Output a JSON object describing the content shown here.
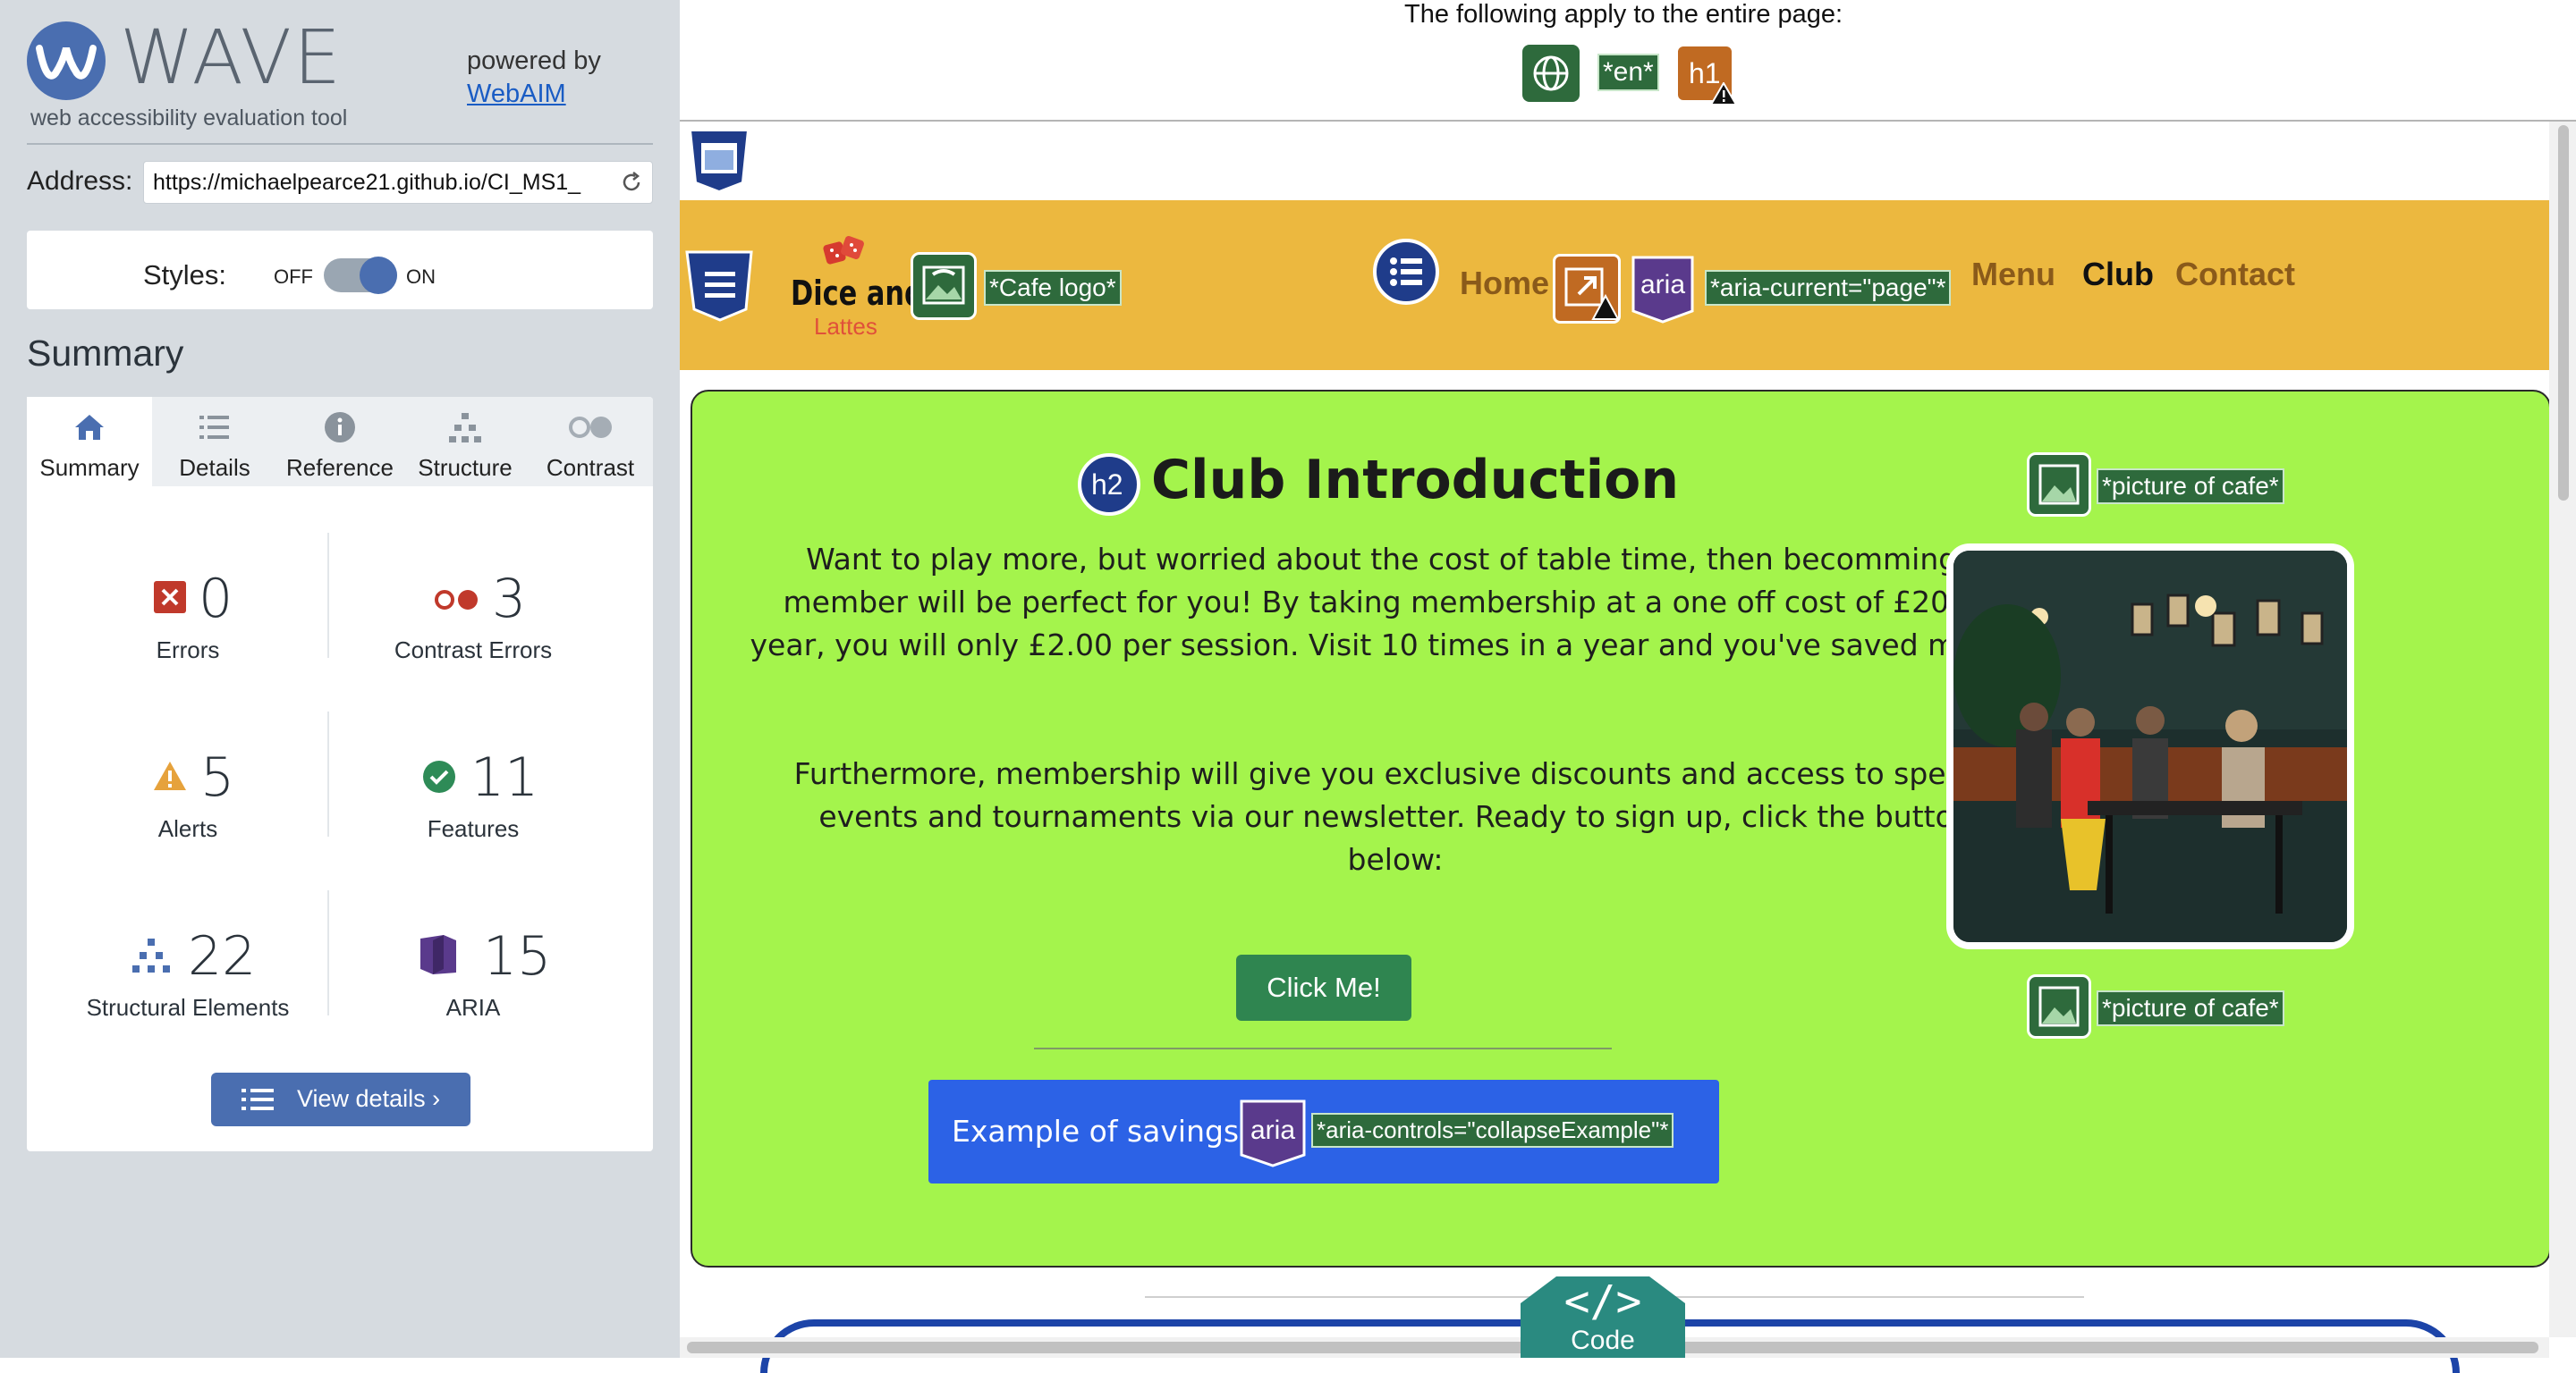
{
  "wave": {
    "title": "WAVE",
    "tagline": "web accessibility evaluation tool",
    "powered_by": "powered by",
    "webaim_link": "WebAIM",
    "address_label": "Address:",
    "address_value": "https://michaelpearce21.github.io/CI_MS1_",
    "styles_label": "Styles:",
    "styles_off": "OFF",
    "styles_on": "ON",
    "summary_heading": "Summary",
    "tabs": [
      {
        "label": "Summary",
        "icon": "home-icon"
      },
      {
        "label": "Details",
        "icon": "list-icon"
      },
      {
        "label": "Reference",
        "icon": "info-icon"
      },
      {
        "label": "Structure",
        "icon": "hierarchy-icon"
      },
      {
        "label": "Contrast",
        "icon": "contrast-icon"
      }
    ],
    "stats": {
      "errors": {
        "count": "0",
        "label": "Errors"
      },
      "contrast_errors": {
        "count": "3",
        "label": "Contrast Errors"
      },
      "alerts": {
        "count": "5",
        "label": "Alerts"
      },
      "features": {
        "count": "11",
        "label": "Features"
      },
      "structural": {
        "count": "22",
        "label": "Structural Elements"
      },
      "aria": {
        "count": "15",
        "label": "ARIA"
      }
    },
    "view_details": "View details ›",
    "accent": "#4a6eb0"
  },
  "page_level": {
    "text": "The following apply to the entire page:",
    "lang_tag": "*en*",
    "h1_tag": "h1"
  },
  "site": {
    "logo_line1": "Dice and",
    "logo_line2": "Lattes",
    "cafe_logo_alt": "*Cafe logo*",
    "nav": {
      "home": "Home",
      "aria_tag": "aria",
      "aria_current": "*aria-current=\"page\"*",
      "menu": "Menu",
      "club": "Club",
      "contact": "Contact"
    },
    "h2_tag": "h2",
    "heading": "Club Introduction",
    "para1": "Want to play more, but worried about the cost of table time, then becomming a member will be perfect for you! By taking membership at a one off cost of £20 per year, you will only £2.00 per session. Visit 10 times in a year and you've saved money!",
    "para2": "Furthermore, membership will give you exclusive discounts and access to special events and tournaments via our newsletter. Ready to sign up, click the button below:",
    "click_button": "Click Me!",
    "savings_button": "Example of savings",
    "savings_aria_tag": "aria",
    "savings_aria_controls": "*aria-controls=\"collapseExample\"*",
    "picture_alt_top": "*picture of cafe*",
    "picture_alt_bottom": "*picture of cafe*",
    "navbar_color": "#ecb83f",
    "content_color": "#a4f44c"
  },
  "code_tab": {
    "glyph": "</>",
    "label": "Code"
  }
}
